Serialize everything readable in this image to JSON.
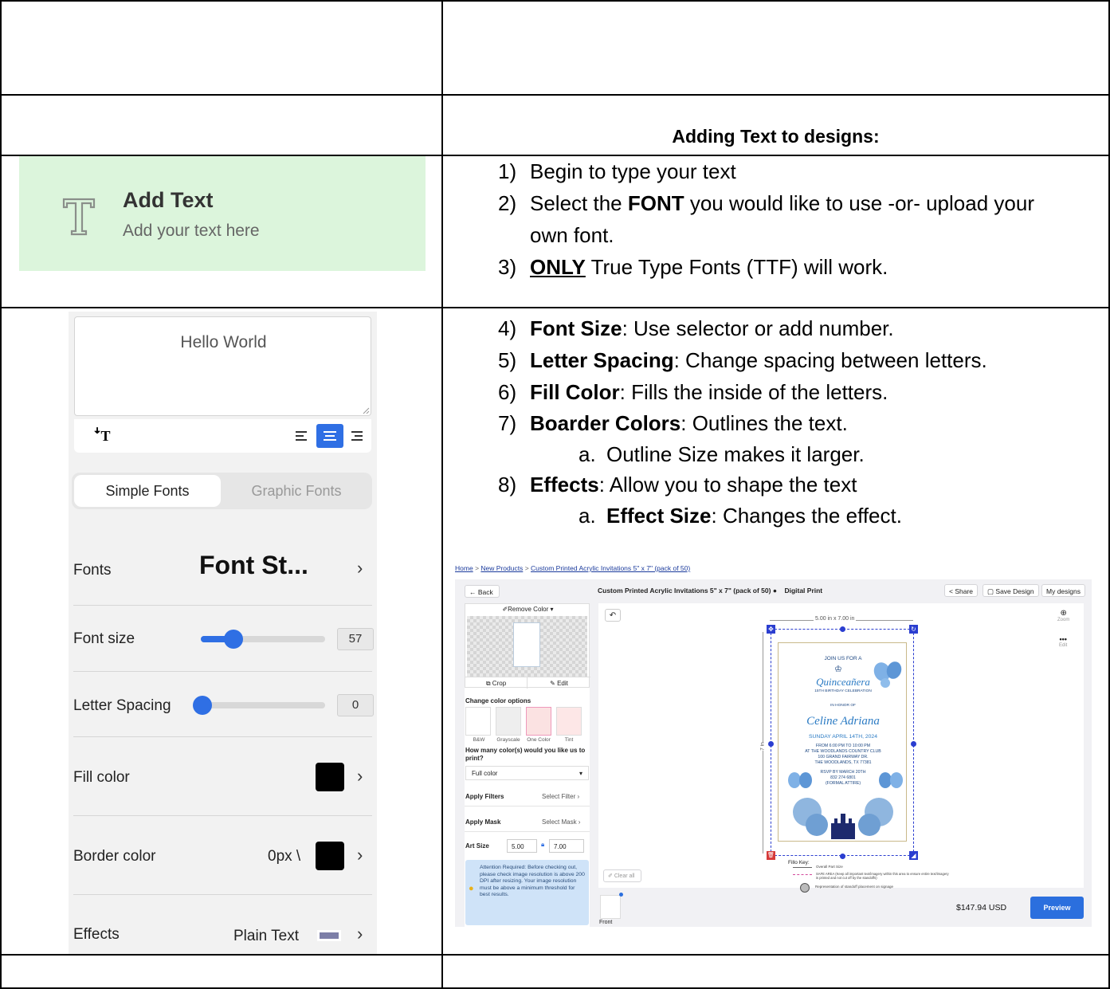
{
  "doc": {
    "heading": "Adding Text to designs:",
    "steps_a": [
      {
        "num": "1)",
        "text": "Begin to type your text"
      },
      {
        "num": "2)",
        "pre": "Select the ",
        "bold": "FONT",
        "post": " you would like to use -or- upload your"
      },
      {
        "cont": "own font."
      },
      {
        "num": "3)",
        "bold_u": "ONLY",
        "post": " True Type Fonts (TTF) will work."
      }
    ],
    "steps_b": [
      {
        "num": "4)",
        "bold": "Font Size",
        "post": ": Use selector or add number."
      },
      {
        "num": "5)",
        "bold": "Letter Spacing",
        "post": ": Change spacing between letters."
      },
      {
        "num": "6)",
        "bold": "Fill Color",
        "post": ": Fills the inside of the letters."
      },
      {
        "num": "7)",
        "bold": "Boarder Colors",
        "post": ": Outlines the text."
      },
      {
        "sub": "a.",
        "post": "Outline Size makes it larger."
      },
      {
        "num": "8)",
        "bold": "Effects",
        "post": ": Allow you to shape the text"
      },
      {
        "sub": "a.",
        "bold": "Effect Size",
        "post": ": Changes the effect."
      }
    ]
  },
  "add_text": {
    "title": "Add Text",
    "subtitle": "Add your text here",
    "icon": "text-t-icon"
  },
  "editor": {
    "text_value": "Hello World",
    "tabs": [
      "Simple Fonts",
      "Graphic Fonts"
    ],
    "active_tab": 0,
    "fonts_label": "Fonts",
    "fonts_value": "Font St...",
    "font_size_label": "Font size",
    "font_size_value": "57",
    "font_size_level": 0.22,
    "letter_spacing_label": "Letter Spacing",
    "letter_spacing_value": "0",
    "letter_spacing_level": 0,
    "fill_label": "Fill color",
    "fill_color": "#000000",
    "border_label": "Border color",
    "border_value": "0px \\",
    "border_color": "#000000",
    "effects_label": "Effects",
    "effects_value": "Plain Text",
    "accent": "#2f6fe4"
  },
  "web": {
    "breadcrumb": [
      "Home",
      "New Products",
      "Custom Printed Acrylic Invitations 5\" x 7\" (pack of 50)"
    ],
    "back": "Back",
    "product_title": "Custom Printed Acrylic Invitations 5\" x 7\" (pack of 50)",
    "print_type": "Digital Print",
    "share": "Share",
    "save_design": "Save Design",
    "my_designs": "My designs",
    "remove_color": "Remove Color",
    "crop": "Crop",
    "edit": "Edit",
    "change_color_options": "Change color options",
    "color_options": [
      "B&W",
      "Grayscale",
      "One Color",
      "Tint"
    ],
    "how_many": "How many color(s) would you like us to print?",
    "full_color": "Full color",
    "apply_filters": "Apply Filters",
    "select_filter": "Select Filter",
    "apply_mask": "Apply Mask",
    "select_mask": "Select Mask",
    "art_size": "Art Size",
    "art_w": "5.00",
    "art_h": "7.00",
    "attention": "Attention Required: Before checking out, please check image resolution is above 200 DPI after resizing. Your image resolution must be above a minimum threshold for best results.",
    "clear_all": "Clear all",
    "dimension": "5.00 in x 7.00 in",
    "side_dim": "7 in",
    "zoom": "Zoom",
    "edit_right": "Edit",
    "invite": [
      "JOIN US FOR A",
      "Quinceañera",
      "15TH BIRTHDAY CELEBRATION",
      "IN HONOR OF",
      "Celine Adriana",
      "SUNDAY APRIL 14TH, 2024",
      "FROM 6:00 PM TO 10:00 PM",
      "AT THE WOODLANDS COUNTRY CLUB",
      "100 GRAND FAIRWAY DR.",
      "THE WOODLANDS, TX 77381",
      "RSVP BY MARCH 20TH",
      "832 274 6801",
      "(FORMAL ATTIRE)"
    ],
    "fillo_key": "Fillo Key:",
    "key_items": [
      "Overall Part Size",
      "SAFE AREA (Keep all important text/imagery within this area to ensure entire text/imagery is printed and not cut off by the standoffs)",
      "Representation of standoff placement on signage"
    ],
    "price": "$147.94 USD",
    "preview": "Preview",
    "front": "Front"
  }
}
